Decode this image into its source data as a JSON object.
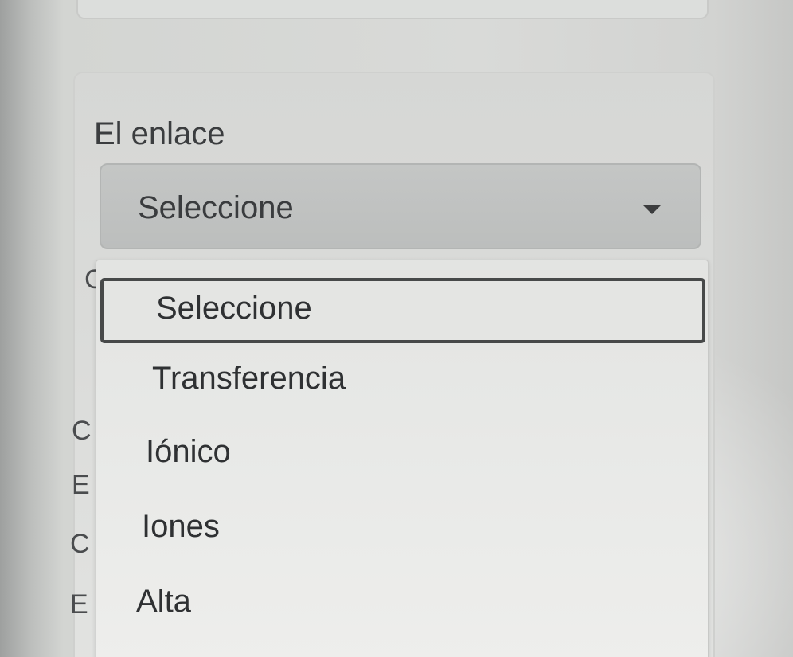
{
  "form": {
    "field_label": "El enlace",
    "select_value": "Seleccione",
    "options": [
      "Seleccione",
      "Transferencia",
      "Iónico",
      "Iones",
      "Alta"
    ],
    "selected_index": 0
  },
  "left_fragments": [
    "C",
    "C",
    "E",
    "C",
    "E"
  ],
  "icons": {
    "dropdown_caret": "caret-down-icon"
  }
}
